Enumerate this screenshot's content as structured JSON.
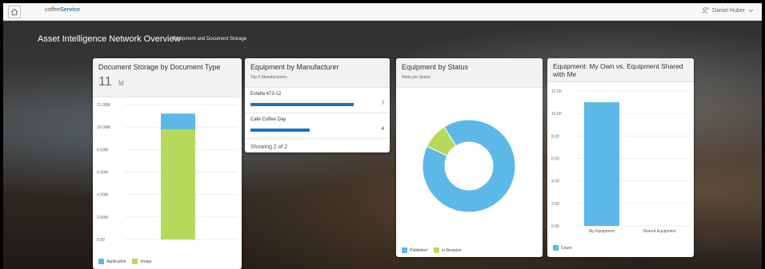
{
  "shell": {
    "logo_prefix": "coffee",
    "logo_brand": "Service",
    "user_name": "Daniel Huber"
  },
  "page": {
    "title": "Asset Intelligence Network Overview",
    "subtitle": "Equipment and Document Storage"
  },
  "cards": {
    "doc_storage": {
      "title": "Document Storage by Document Type",
      "kpi_value": "11",
      "kpi_unit": "M"
    },
    "manufacturer": {
      "title": "Equipment by Manufacturer",
      "subtitle": "Top 5 Manufacturers",
      "items": [
        {
          "name": "Estella 473-12",
          "value": "7"
        },
        {
          "name": "Cafe Coffee Day",
          "value": "4"
        }
      ],
      "showing": "Showing 2 of 2"
    },
    "status": {
      "title": "Equipment by Status",
      "subtitle": "Ratio per Status"
    },
    "own_shared": {
      "title": "Equipment: My Own vs. Equipment Shared with Me"
    }
  },
  "colors": {
    "blue": "#5cb8e6",
    "green": "#b7d95b",
    "bar_dark": "#1476c4"
  },
  "chart_data": [
    {
      "type": "bar",
      "stacked": true,
      "title": "Document Storage by Document Type",
      "categories": [
        ""
      ],
      "series": [
        {
          "name": "Image",
          "values": [
            9.8
          ]
        },
        {
          "name": "Application",
          "values": [
            1.4
          ]
        }
      ],
      "yticks": [
        "0.00",
        "2.00M",
        "4.00M",
        "6.00M",
        "8.00M",
        "10.00M",
        "12.00M"
      ],
      "ylim": [
        0,
        12
      ],
      "grid": true,
      "legend": "bottom-left"
    },
    {
      "type": "bar",
      "orientation": "horizontal",
      "title": "Equipment by Manufacturer",
      "categories": [
        "Estella 473-12",
        "Cafe Coffee Day"
      ],
      "values": [
        7,
        4
      ],
      "xlim": [
        0,
        7
      ]
    },
    {
      "type": "pie",
      "donut": true,
      "title": "Equipment by Status",
      "categories": [
        "Published",
        "In Revision"
      ],
      "values": [
        91,
        9
      ],
      "legend": "bottom-left"
    },
    {
      "type": "bar",
      "title": "Equipment: My Own vs. Equipment Shared with Me",
      "categories": [
        "My Equipment",
        "Shared Equipment"
      ],
      "series": [
        {
          "name": "Count",
          "values": [
            11,
            0
          ]
        }
      ],
      "yticks": [
        "0.00",
        "2.00",
        "4.00",
        "6.00",
        "8.00",
        "10.00",
        "12.00"
      ],
      "ylim": [
        0,
        12
      ],
      "grid": true,
      "legend": "bottom-left"
    }
  ]
}
